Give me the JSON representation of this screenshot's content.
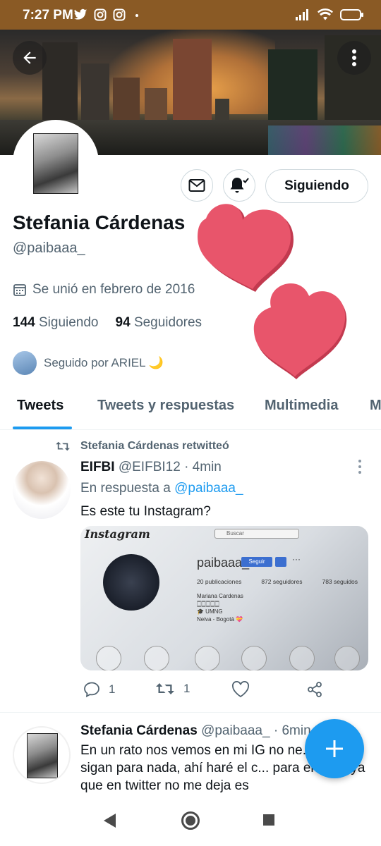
{
  "status_bar": {
    "time": "7:27 PM",
    "icons": [
      "twitter-icon",
      "instagram-icon",
      "instagram-icon",
      "dot-icon"
    ],
    "right_icons": [
      "signal-icon",
      "wifi-icon",
      "battery-icon"
    ]
  },
  "profile": {
    "name": "Stefania Cárdenas",
    "handle": "@paibaaa_",
    "joined": "Se unió en febrero de 2016",
    "following_count": "144",
    "following_label": "Siguiendo",
    "followers_count": "94",
    "followers_label": "Seguidores",
    "followed_by": "Seguido por ARIEL 🌙",
    "follow_button": "Siguiendo"
  },
  "tabs": [
    "Tweets",
    "Tweets y respuestas",
    "Multimedia",
    "Me gusta"
  ],
  "tweets": [
    {
      "retweet_label": "Stefania Cárdenas retwitteó",
      "author": "EIFBI",
      "handle": "@EIFBI12",
      "time": "· 4min",
      "reply_prefix": "En respuesta a",
      "reply_to": "@paibaaa_",
      "text": "Es este tu Instagram?",
      "media": {
        "app_logo": "Instagram",
        "search_placeholder": "Buscar",
        "username": "paibaaa_",
        "follow_label": "Seguir",
        "more": "···",
        "posts": "20 publicaciones",
        "followers": "872 seguidores",
        "following": "783 seguidos",
        "bio": "Mariana Cardenas\n🀆🀆🀆🀆🀆\n🎓 UMNG\nNeiva - Bogotá 💝"
      },
      "replies": "1",
      "retweets": "1"
    },
    {
      "author": "Stefania Cárdenas",
      "handle": "@paibaaa_",
      "time": "· 6min",
      "text": "En un rato nos vemos en mi IG no ne... que me sigan para nada, ahí haré el c... para el meet ya que en twitter no me deja es"
    }
  ],
  "colors": {
    "accent": "#1d9bf0",
    "status_bar": "#8a5a25",
    "heart": "#e8556b",
    "text_secondary": "#536471"
  }
}
